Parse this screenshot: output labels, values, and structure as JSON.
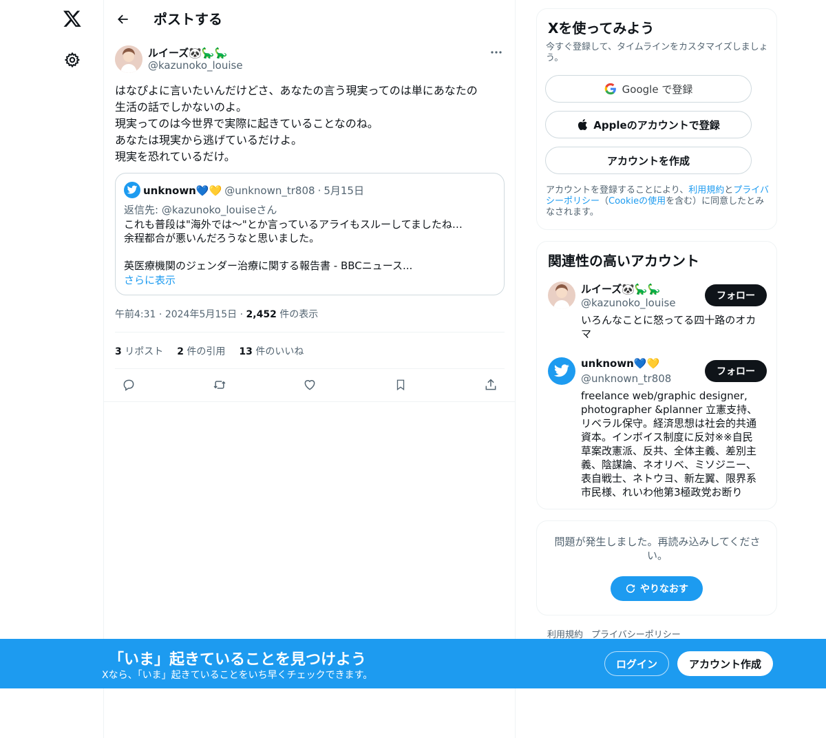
{
  "header": {
    "title": "ポストする"
  },
  "tweet": {
    "author_name": "ルイーズ🐼🦕🦕",
    "author_handle": "@kazunoko_louise",
    "text": "はなぴよに言いたいんだけどさ、あなたの言う現実ってのは単にあなたの\n生活の話でしかないのよ。\n現実ってのは今世界で実際に起きていることなのね。\nあなたは現実から逃げているだけよ。\n現実を恐れているだけ。",
    "quote": {
      "name": "unknown💙💛",
      "handle": "@unknown_tr808",
      "date": "5月15日",
      "reply_to": "返信先: @kazunoko_louiseさん",
      "body": "これも普段は\"海外では〜\"とか言っているアライもスルーしてましたね…\n余程都合が悪いんだろうなと思いました。\n\n英医療機関のジェンダー治療に関する報告書 - BBCニュース...",
      "show_more": "さらに表示"
    },
    "time": "午前4:31",
    "date": "2024年5月15日",
    "views_count": "2,452",
    "views_label": "件の表示",
    "stats": {
      "reposts_count": "3",
      "reposts_label": "リポスト",
      "quotes_count": "2",
      "quotes_label": "件の引用",
      "likes_count": "13",
      "likes_label": "件のいいね"
    }
  },
  "signup": {
    "title": "Xを使ってみよう",
    "subtitle": "今すぐ登録して、タイムラインをカスタマイズしましょう。",
    "google_label": "Google で登録",
    "apple_label": "Appleのアカウントで登録",
    "create_label": "アカウントを作成",
    "legal_prefix": "アカウントを登録することにより、",
    "legal_terms": "利用規約",
    "legal_and": "と",
    "legal_privacy": "プライバシーポリシー",
    "legal_paren_open": "（",
    "legal_cookie": "Cookieの使用",
    "legal_suffix": "を含む）に同意したとみなされます。"
  },
  "related": {
    "title": "関連性の高いアカウント",
    "accounts": [
      {
        "name": "ルイーズ🐼🦕🦕",
        "handle": "@kazunoko_louise",
        "bio": "いろんなことに怒ってる四十路のオカマ",
        "follow_label": "フォロー"
      },
      {
        "name": "unknown💙💛",
        "handle": "@unknown_tr808",
        "bio": "freelance web/graphic designer, photographer &planner 立憲支持、リベラル保守。経済思想は社会的共通資本。インボイス制度に反対※※自民草案改憲派、反共、全体主義、差別主義、陰謀論、ネオリベ、ミソジニー、表自戦士、ネトウヨ、新左翼、限界系市民様、れいわ他第3極政党お断り",
        "follow_label": "フォロー"
      }
    ]
  },
  "error": {
    "message": "問題が発生しました。再読み込みしてください。",
    "retry_label": "やりなおす"
  },
  "footer": {
    "terms": "利用規約",
    "privacy": "プライバシーポリシー"
  },
  "banner": {
    "title": "「いま」起きていることを見つけよう",
    "subtitle": "Xなら、「いま」起きていることをいち早くチェックできます。",
    "login_label": "ログイン",
    "signup_label": "アカウント作成"
  },
  "colors": {
    "accent": "#1d9bf0",
    "text": "#0f1419",
    "muted": "#536471"
  }
}
